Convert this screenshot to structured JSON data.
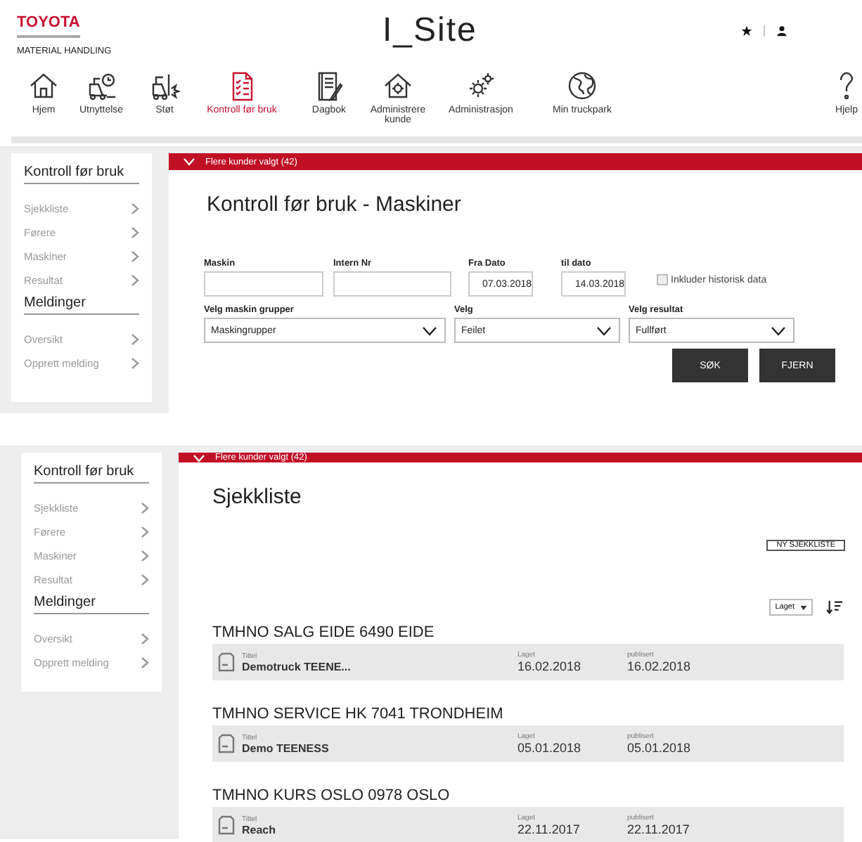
{
  "header": {
    "brand": "TOYOTA",
    "brand_sub": "MATERIAL HANDLING",
    "app_title": "I_Site"
  },
  "nav": [
    {
      "label": "Hjem",
      "selected": false
    },
    {
      "label": "Utnyttelse",
      "selected": false
    },
    {
      "label": "Støt",
      "selected": false
    },
    {
      "label": "Kontroll før bruk",
      "selected": true
    },
    {
      "label": "Dagbok",
      "selected": false
    },
    {
      "label": "Administrere kunde",
      "selected": false
    },
    {
      "label": "Administrasjon",
      "selected": false
    },
    {
      "label": "Min truckpark",
      "selected": false
    },
    {
      "label": "Hjelp",
      "selected": false
    }
  ],
  "panels": [
    {
      "kind": "filter",
      "sidebar": [
        {
          "title": "Kontroll før bruk",
          "items": [
            "Sjekkliste",
            "Førere",
            "Maskiner",
            "Resultat"
          ]
        },
        {
          "title": "Meldinger",
          "items": [
            "Oversikt",
            "Opprett melding"
          ]
        }
      ],
      "banner": "Flere kunder valgt (42)",
      "title": "Kontroll før bruk - Maskiner",
      "fields": [
        {
          "label": "Maskin"
        },
        {
          "label": "Intern Nr"
        },
        {
          "label": "Fra Dato",
          "value": "07.03.2018"
        },
        {
          "label": "til dato",
          "value": "14.03.2018"
        }
      ],
      "checkbox": {
        "label": "Inkluder historisk data",
        "checked": false
      },
      "selects": [
        {
          "label": "Velg maskin grupper",
          "value": "Maskingrupper"
        },
        {
          "label": "Velg",
          "value": "Feilet"
        },
        {
          "label": "Velg resultat",
          "value": "Fullført"
        }
      ],
      "buttons": [
        "SØK",
        "FJERN"
      ]
    },
    {
      "kind": "list",
      "sidebar": [
        {
          "title": "Kontroll før bruk",
          "items": [
            "Sjekkliste",
            "Førere",
            "Maskiner",
            "Resultat"
          ]
        },
        {
          "title": "Meldinger",
          "items": [
            "Oversikt",
            "Opprett melding"
          ]
        }
      ],
      "banner": "Flere kunder valgt (42)",
      "title": "Sjekkliste",
      "new_button": "NY SJEKKLISTE",
      "sort": "Laget",
      "groups": [
        {
          "customer": "TMHNO SALG EIDE 6490 EIDE",
          "title_label": "Tittel",
          "title": "Demotruck TEENE...",
          "created_label": "Laget",
          "created": "16.02.2018",
          "published_label": "publisert",
          "published": "16.02.2018"
        },
        {
          "customer": "TMHNO SERVICE HK 7041 TRONDHEIM",
          "title_label": "Tittel",
          "title": "Demo TEENESS",
          "created_label": "Laget",
          "created": "05.01.2018",
          "published_label": "publisert",
          "published": "05.01.2018"
        },
        {
          "customer": "TMHNO KURS OSLO 0978 OSLO",
          "title_label": "Tittel",
          "title": "Reach",
          "created_label": "Laget",
          "created": "22.11.2017",
          "published_label": "publisert",
          "published": "22.11.2017"
        }
      ]
    }
  ]
}
